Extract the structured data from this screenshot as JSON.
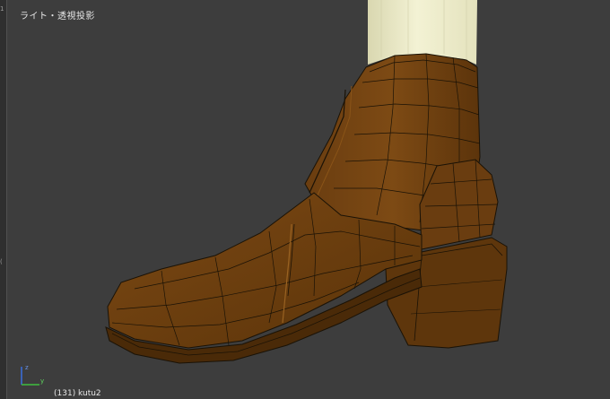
{
  "viewport": {
    "view_label": "ライト・透視投影",
    "object_label": "(131) kutu2",
    "left_strip_marks": [
      "1",
      "("
    ],
    "axis": {
      "z_label": "z",
      "y_label": "y"
    },
    "colors": {
      "background": "#3d3d3d",
      "boot": "#6b3e0f",
      "boot_light": "#8a5418",
      "boot_dark": "#4a2a08",
      "wire": "#1a1206",
      "leg": "#f0efcc",
      "axis_z": "#3a6cd6",
      "axis_y": "#3fbf3f"
    }
  }
}
